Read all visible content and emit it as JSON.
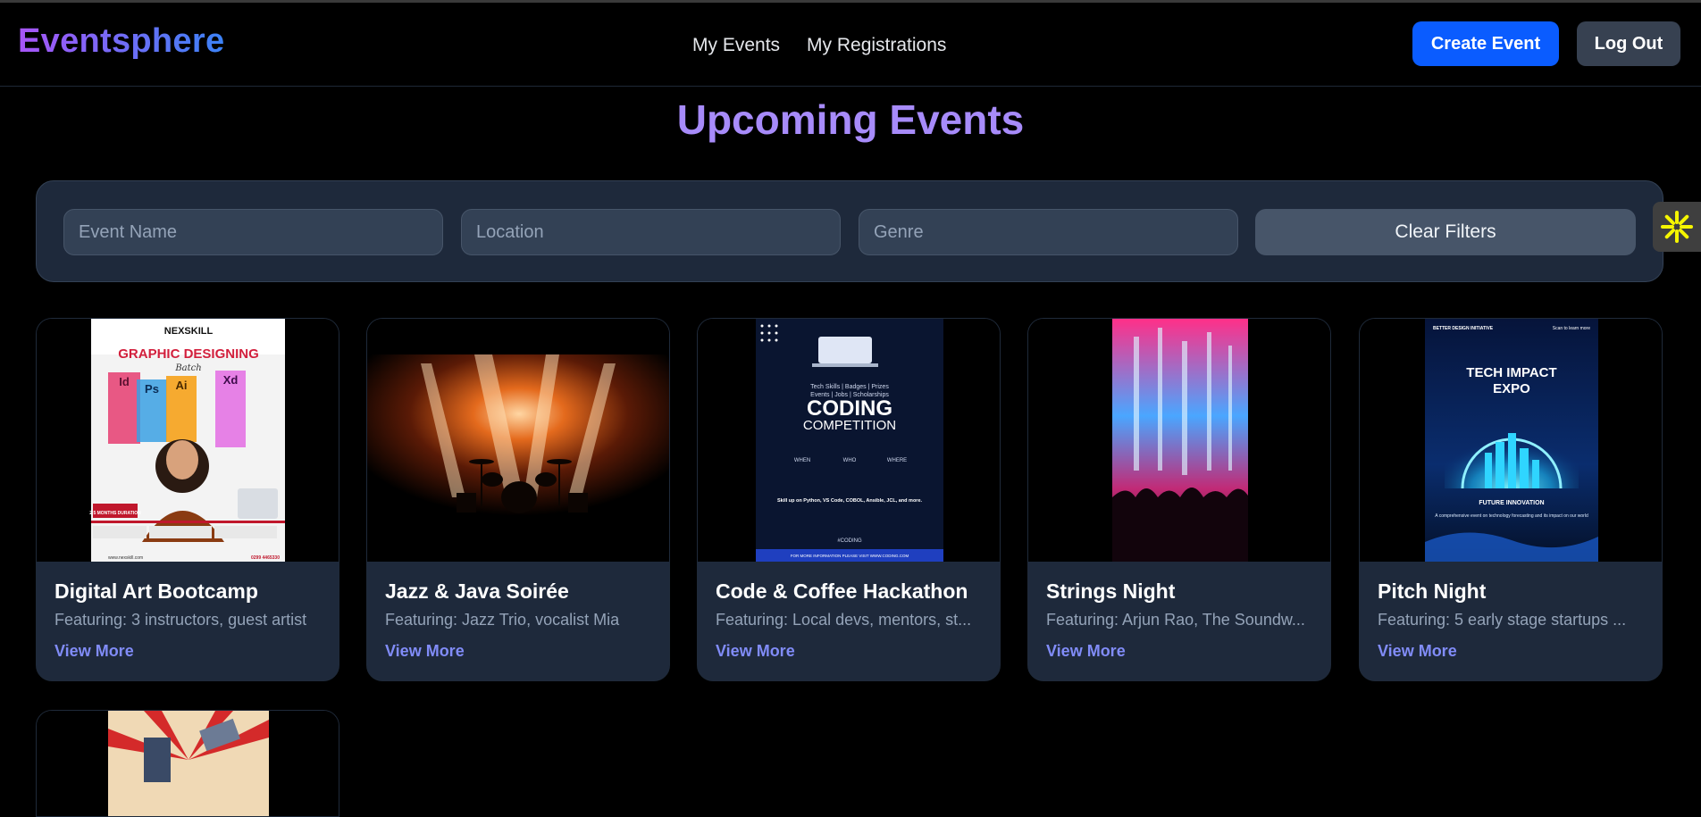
{
  "app": {
    "brand": "Eventsphere"
  },
  "nav": {
    "links": [
      "My Events",
      "My Registrations"
    ]
  },
  "actions": {
    "create": "Create Event",
    "logout": "Log Out"
  },
  "page": {
    "title": "Upcoming Events"
  },
  "filters": {
    "event_name_placeholder": "Event Name",
    "location_placeholder": "Location",
    "genre_placeholder": "Genre",
    "clear_label": "Clear Filters"
  },
  "events": [
    {
      "title": "Digital Art Bootcamp",
      "featuring": "Featuring: 3 instructors, guest artist",
      "link": "View More",
      "poster": {
        "brand": "NEXSKILL",
        "headline": "GRAPHIC DESIGNING",
        "sub": "Batch",
        "badges": [
          "Id",
          "Ps",
          "Ai",
          "Xd"
        ],
        "duration": "2.5 MONTHS DURATION",
        "phone": "0299 4465330",
        "site": "www.nexskill.com"
      }
    },
    {
      "title": "Jazz & Java Soirée",
      "featuring": "Featuring: Jazz Trio, vocalist Mia",
      "link": "View More"
    },
    {
      "title": "Code & Coffee Hackathon",
      "featuring": "Featuring: Local devs, mentors, st...",
      "link": "View More",
      "poster": {
        "tags": "Tech Skills | Badges | Prizes",
        "tags2": "Events | Jobs | Scholarships",
        "headline": "CODING",
        "sub": "COMPETITION",
        "cols": [
          "WHEN",
          "WHO",
          "WHERE"
        ],
        "blurb": "Skill up on Python, VS Code, COBOL, Ansible, JCL, and more.",
        "hashtag": "#CODING",
        "footer": "FOR MORE INFORMATION PLEASE VISIT WWW.CODING.COM"
      }
    },
    {
      "title": "Strings Night",
      "featuring": "Featuring: Arjun Rao, The Soundw...",
      "link": "View More"
    },
    {
      "title": "Pitch Night",
      "featuring": "Featuring: 5 early stage startups ...",
      "link": "View More",
      "poster": {
        "org": "BETTER DESIGN INITIATIVE",
        "cta": "Scan to learn more",
        "headline1": "TECH IMPACT",
        "headline2": "EXPO",
        "tagline": "FUTURE INNOVATION",
        "blurb": "A comprehensive event on technology forecasting and its impact on our world"
      }
    }
  ]
}
